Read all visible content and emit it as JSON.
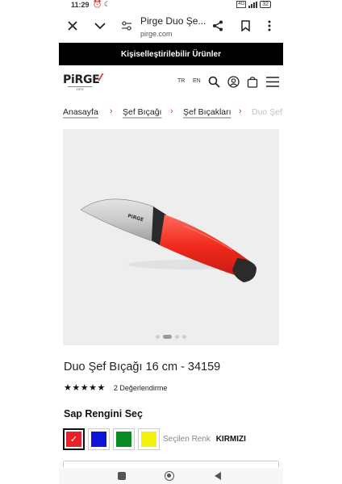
{
  "status": {
    "time": "11:29",
    "network": "4G",
    "battery": "32"
  },
  "browser": {
    "tab_title": "Pirge Duo Şe...",
    "url": "pirge.com",
    "icons": [
      "close-icon",
      "chevron-down-icon",
      "tune-icon",
      "share-icon",
      "bookmark-icon",
      "more-vert-icon"
    ]
  },
  "promo": {
    "text": "Kişiselleştirilebilir Ürünler"
  },
  "site": {
    "logo_text": "PiRGE",
    "logo_since": "1979",
    "lang_tr": "TR",
    "lang_en": "EN",
    "icons": [
      "search-icon",
      "account-icon",
      "bag-icon",
      "menu-icon"
    ]
  },
  "breadcrumb": {
    "items": [
      "Anasayfa",
      "Şef Bıçağı",
      "Şef Bıçakları",
      "Duo Şef"
    ]
  },
  "gallery": {
    "image_count": 4,
    "active_index": 1
  },
  "product": {
    "title": "Duo Şef Bıçağı 16 cm - 34159",
    "rating_stars": 5,
    "rating_text": "2 Değerlendirme",
    "color_heading": "Sap Rengini Seç",
    "selected_label": "Seçilen Renk",
    "selected_value": "KIRMIZI",
    "colors": [
      {
        "name": "red",
        "hex": "#e8222a",
        "selected": true
      },
      {
        "name": "blue",
        "hex": "#0d16d8",
        "selected": false
      },
      {
        "name": "green",
        "hex": "#0a8a23",
        "selected": false
      },
      {
        "name": "yellow",
        "hex": "#f5f10f",
        "selected": false
      }
    ]
  },
  "colors": {
    "accent_red": "#e53935",
    "promo_bg": "#000000",
    "gallery_bg": "#eeeeee"
  }
}
